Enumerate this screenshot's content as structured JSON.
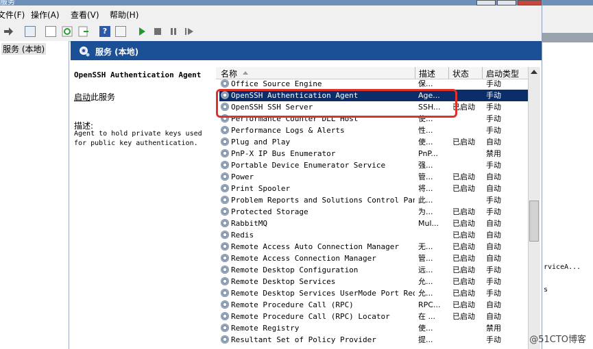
{
  "window": {
    "title": "服务"
  },
  "menu": [
    "文件(F)",
    "操作(A)",
    "查看(V)",
    "帮助(H)"
  ],
  "tree": {
    "root_label": "服务 (本地)"
  },
  "header": {
    "title": "服务 (本地)"
  },
  "details": {
    "service_name": "OpenSSH Authentication Agent",
    "start_link": "启动",
    "start_suffix": "此服务",
    "description_label": "描述:",
    "description": "Agent to hold private keys used for public key authentication."
  },
  "columns": {
    "name": "名称",
    "description": "描述",
    "status": "状态",
    "startup": "启动类型"
  },
  "services": [
    {
      "name": "Office Source Engine",
      "desc": "保...",
      "status": "",
      "startup": "手动"
    },
    {
      "name": "OpenSSH Authentication Agent",
      "desc": "Age...",
      "status": "",
      "startup": "手动"
    },
    {
      "name": "OpenSSH SSH Server",
      "desc": "SSH...",
      "status": "已启动",
      "startup": "手动"
    },
    {
      "name": "Performance Counter DLL Host",
      "desc": "使...",
      "status": "",
      "startup": "手动"
    },
    {
      "name": "Performance Logs & Alerts",
      "desc": "性...",
      "status": "",
      "startup": "手动"
    },
    {
      "name": "Plug and Play",
      "desc": "使...",
      "status": "已启动",
      "startup": "自动"
    },
    {
      "name": "PnP-X IP Bus Enumerator",
      "desc": "PnP...",
      "status": "",
      "startup": "禁用"
    },
    {
      "name": "Portable Device Enumerator Service",
      "desc": "强...",
      "status": "",
      "startup": "手动"
    },
    {
      "name": "Power",
      "desc": "管...",
      "status": "已启动",
      "startup": "自动"
    },
    {
      "name": "Print Spooler",
      "desc": "将...",
      "status": "已启动",
      "startup": "自动"
    },
    {
      "name": "Problem Reports and Solutions Control Pan...",
      "desc": "此...",
      "status": "",
      "startup": "手动"
    },
    {
      "name": "Protected Storage",
      "desc": "为...",
      "status": "已启动",
      "startup": "手动"
    },
    {
      "name": "RabbitMQ",
      "desc": "Mul...",
      "status": "已启动",
      "startup": "自动"
    },
    {
      "name": "Redis",
      "desc": "",
      "status": "已启动",
      "startup": "自动"
    },
    {
      "name": "Remote Access Auto Connection Manager",
      "desc": "无...",
      "status": "已启动",
      "startup": "自动"
    },
    {
      "name": "Remote Access Connection Manager",
      "desc": "管...",
      "status": "已启动",
      "startup": "自动"
    },
    {
      "name": "Remote Desktop Configuration",
      "desc": "远...",
      "status": "已启动",
      "startup": "手动"
    },
    {
      "name": "Remote Desktop Services",
      "desc": "允...",
      "status": "已启动",
      "startup": "手动"
    },
    {
      "name": "Remote Desktop Services UserMode Port Red...",
      "desc": "允...",
      "status": "已启动",
      "startup": "手动"
    },
    {
      "name": "Remote Procedure Call (RPC)",
      "desc": "RPC...",
      "status": "已启动",
      "startup": "自动"
    },
    {
      "name": "Remote Procedure Call (RPC) Locator",
      "desc": "在 ...",
      "status": "已启动",
      "startup": "自动"
    },
    {
      "name": "Remote Registry",
      "desc": "使...",
      "status": "",
      "startup": "禁用"
    },
    {
      "name": "Resultant Set of Policy Provider",
      "desc": "提...",
      "status": "",
      "startup": "手动"
    }
  ],
  "selected_service": "OpenSSH Authentication Agent",
  "right_fragments": [
    "rviceA...",
    "s"
  ],
  "watermark": "@51CTO博客"
}
